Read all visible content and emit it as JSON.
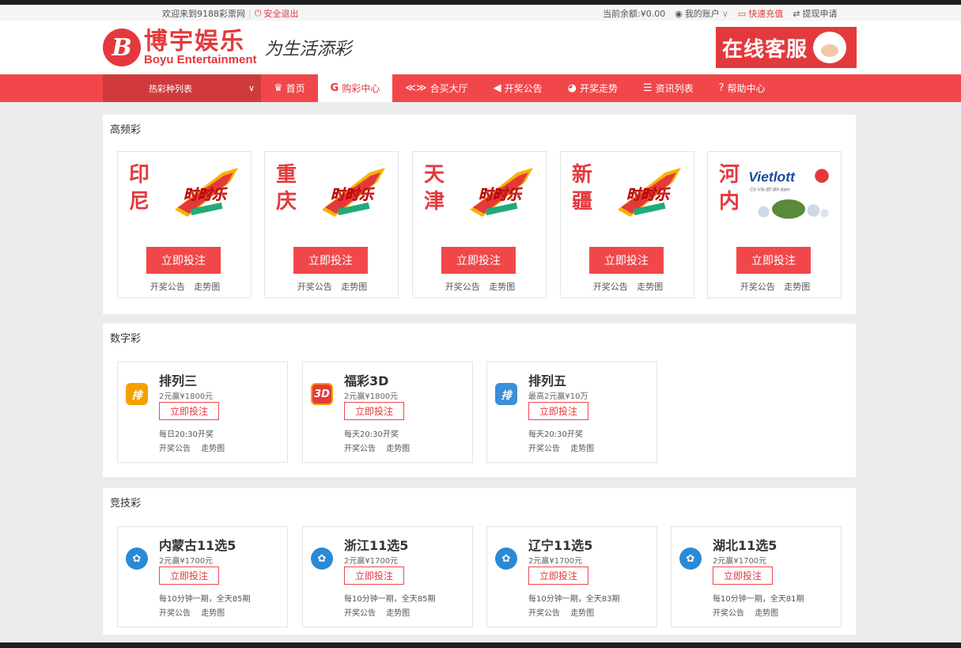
{
  "topbar": {
    "welcome": "欢迎来到9188彩票网",
    "logout": "安全退出",
    "balance": "当前余额:¥0.00",
    "account": "我的账户",
    "recharge": "快速充值",
    "withdraw": "提现申请"
  },
  "brand": {
    "logo_letter": "B",
    "logo_cn": "博宇娱乐",
    "logo_en": "Boyu Entertainment",
    "slogan": "为生活添彩",
    "service": "在线客服"
  },
  "nav": {
    "select_label": "热彩种列表",
    "items": [
      {
        "label": "首页",
        "icon": "crown-icon"
      },
      {
        "label": "购彩中心",
        "icon": "g-icon",
        "active": true
      },
      {
        "label": "合买大厅",
        "icon": "handshake-icon"
      },
      {
        "label": "开奖公告",
        "icon": "megaphone-icon"
      },
      {
        "label": "开奖走势",
        "icon": "pie-chart-icon"
      },
      {
        "label": "资讯列表",
        "icon": "list-icon"
      },
      {
        "label": "帮助中心",
        "icon": "help-icon"
      }
    ]
  },
  "sections": {
    "high_freq": {
      "title": "高频彩",
      "cards": [
        {
          "city": "印尼",
          "logo": "时时乐",
          "button": "立即投注",
          "link1": "开奖公告",
          "link2": "走势图"
        },
        {
          "city": "重庆",
          "logo": "时时乐",
          "button": "立即投注",
          "link1": "开奖公告",
          "link2": "走势图"
        },
        {
          "city": "天津",
          "logo": "时时乐",
          "button": "立即投注",
          "link1": "开奖公告",
          "link2": "走势图"
        },
        {
          "city": "新疆",
          "logo": "时时乐",
          "button": "立即投注",
          "link1": "开奖公告",
          "link2": "走势图"
        },
        {
          "city": "河内",
          "logo": "Vietlott",
          "logo_sub": "Có Vải đổ đời dam",
          "button": "立即投注",
          "link1": "开奖公告",
          "link2": "走势图"
        }
      ]
    },
    "digital": {
      "title": "数字彩",
      "cards": [
        {
          "name": "排列三",
          "icon_text": "排",
          "prize": "2元赢¥1800元",
          "button": "立即投注",
          "time": "每日20:30开奖",
          "link1": "开奖公告",
          "link2": "走势图"
        },
        {
          "name": "福彩3D",
          "icon_text": "3D",
          "prize": "2元赢¥1800元",
          "button": "立即投注",
          "time": "每天20:30开奖",
          "link1": "开奖公告",
          "link2": "走势图"
        },
        {
          "name": "排列五",
          "icon_text": "排",
          "prize": "最高2元赢¥10万",
          "button": "立即投注",
          "time": "每天20:30开奖",
          "link1": "开奖公告",
          "link2": "走势图"
        }
      ]
    },
    "sports": {
      "title": "竞技彩",
      "cards": [
        {
          "name": "内蒙古11选5",
          "prize": "2元赢¥1700元",
          "button": "立即投注",
          "time": "每10分钟一期，全天85期",
          "link1": "开奖公告",
          "link2": "走势图"
        },
        {
          "name": "浙江11选5",
          "prize": "2元赢¥1700元",
          "button": "立即投注",
          "time": "每10分钟一期，全天85期",
          "link1": "开奖公告",
          "link2": "走势图"
        },
        {
          "name": "辽宁11选5",
          "prize": "2元赢¥1700元",
          "button": "立即投注",
          "time": "每10分钟一期，全天83期",
          "link1": "开奖公告",
          "link2": "走势图"
        },
        {
          "name": "湖北11选5",
          "prize": "2元赢¥1700元",
          "button": "立即投注",
          "time": "每10分钟一期，全天81期",
          "link1": "开奖公告",
          "link2": "走势图"
        }
      ]
    }
  },
  "colors": {
    "accent": "#f2474a",
    "brand_red": "#e4393c",
    "page_bg": "#ececec"
  }
}
